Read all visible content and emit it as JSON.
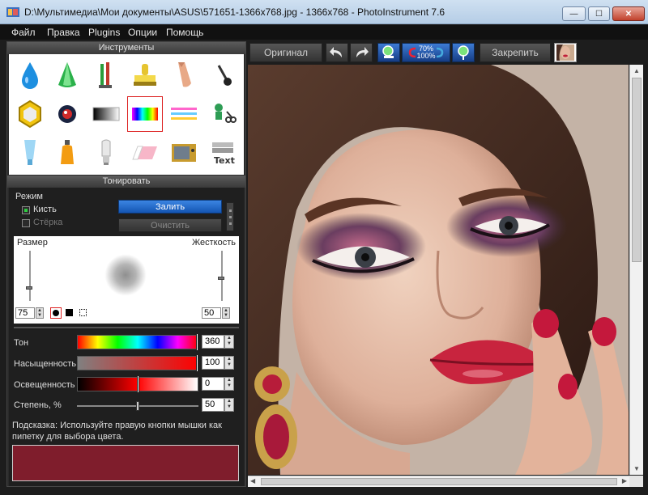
{
  "window": {
    "title": "D:\\Мультимедиа\\Мои документы\\ASUS\\571651-1366x768.jpg - 1366x768 - PhotoInstrument 7.6",
    "minimize_glyph": "—",
    "maximize_glyph": "☐",
    "close_glyph": "✕"
  },
  "menu": [
    "Файл",
    "Правка",
    "Plugins",
    "Опции",
    "Помощь"
  ],
  "tools_panel": {
    "title": "Инструменты",
    "selected_tool": "rainbow-tool"
  },
  "tone_panel": {
    "title": "Тонировать",
    "mode_label": "Режим",
    "brush_label": "Кисть",
    "eraser_label": "Стёрка",
    "fill_button": "Залить",
    "clear_button": "Очистить",
    "size_label": "Размер",
    "hardness_label": "Жесткость",
    "size_value": "75",
    "hardness_value": "50",
    "hue_label": "Тон",
    "hue_value": "360",
    "saturation_label": "Насыщенность",
    "saturation_value": "100",
    "lightness_label": "Освещенность",
    "lightness_value": "0",
    "degree_label": "Степень, %",
    "degree_value": "50",
    "hint": "Подсказка: Используйте правую кнопки мышки как пипетку для выбора цвета.",
    "color_swatch": "#7f1d2c"
  },
  "toolbar": {
    "original_button": "Оригинал",
    "pin_button": "Закрепить",
    "zoom_top": "70%",
    "zoom_bottom": "100%"
  },
  "colors": {
    "accent": "#1a5fc4",
    "selection": "#d22222"
  }
}
